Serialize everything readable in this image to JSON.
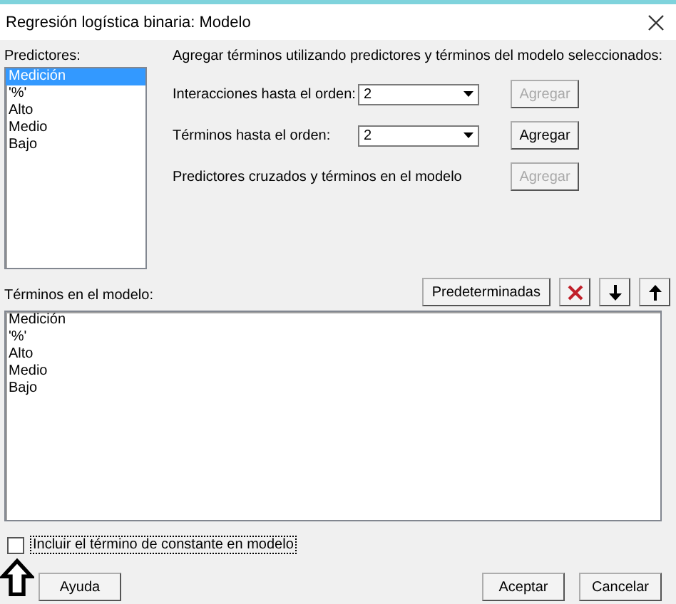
{
  "window": {
    "title": "Regresión logística binaria: Modelo"
  },
  "predictors": {
    "label": "Predictores:",
    "items": [
      {
        "text": "Medición",
        "selected": true
      },
      {
        "text": "'%'",
        "selected": false
      },
      {
        "text": "Alto",
        "selected": false
      },
      {
        "text": "Medio",
        "selected": false
      },
      {
        "text": "Bajo",
        "selected": false
      }
    ]
  },
  "add_terms": {
    "heading": "Agregar términos utilizando predictores y términos del modelo seleccionados:",
    "rows": [
      {
        "kind": "dropdown",
        "label": "Interacciones hasta el orden:",
        "value": "2",
        "button": "Agregar",
        "disabled": true
      },
      {
        "kind": "dropdown",
        "label": "Términos hasta el orden:",
        "value": "2",
        "button": "Agregar",
        "disabled": false
      },
      {
        "kind": "plain",
        "label": "Predictores cruzados y términos en el modelo",
        "button": "Agregar",
        "disabled": true
      }
    ]
  },
  "terms": {
    "label": "Términos en el modelo:",
    "default_button": "Predeterminadas",
    "items": [
      "Medición",
      "'%'",
      "Alto",
      "Medio",
      "Bajo"
    ]
  },
  "constant": {
    "label": "Incluir el término de constante en modelo",
    "checked": false
  },
  "buttons": {
    "help": "Ayuda",
    "ok": "Aceptar",
    "cancel": "Cancelar"
  }
}
